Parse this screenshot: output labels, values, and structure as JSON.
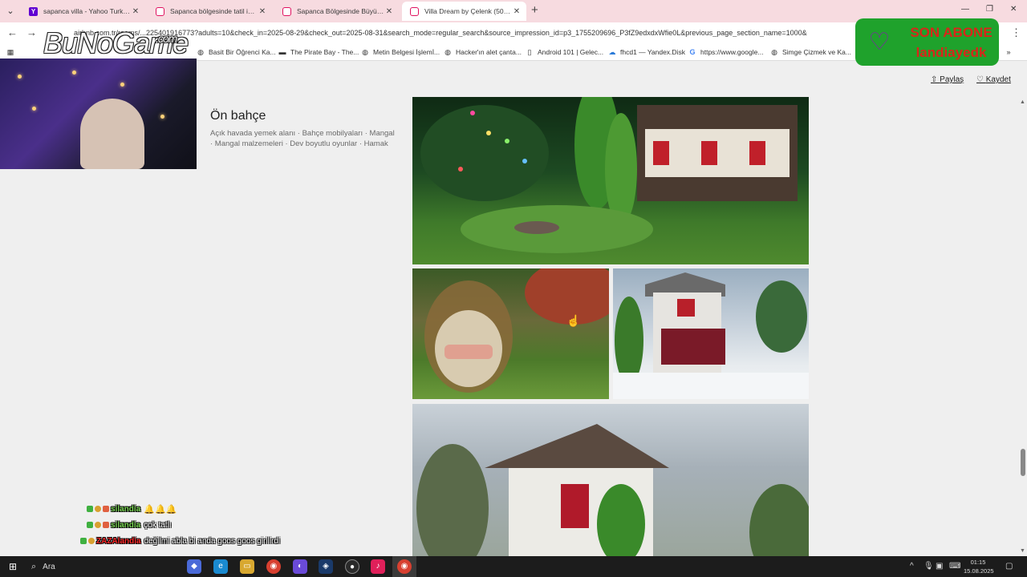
{
  "browser": {
    "tabs": [
      {
        "title": "sapanca villa - Yahoo Turkey Ar",
        "favicon": "yahoo"
      },
      {
        "title": "Sapanca bölgesinde tatil için ki",
        "favicon": "airbnb"
      },
      {
        "title": "Sapanca Bölgesinde Büyük Gru",
        "favicon": "airbnb"
      },
      {
        "title": "Villa Dream by Çelenk (5000 m",
        "favicon": "airbnb",
        "active": true
      }
    ],
    "new_tab_label": "+",
    "url": "airbnb.com.tr/rooms/...225401916773?adults=10&check_in=2025-08-29&check_out=2025-08-31&search_mode=regular_search&source_impression_id=p3_1755209696_P3fZ9edxdxWfie0L&previous_page_section_name=1000&",
    "bookmarks": [
      "Basit Bir Öğrenci Ka...",
      "The Pirate Bay - The...",
      "Metin Belgesi İşlemİ...",
      "Hacker'ın alet çanta...",
      "Android 101 | Gelec...",
      "fhcd1 — Yandex.Disk",
      "https://www.google...",
      "Simge Çizmek ve Ka..."
    ]
  },
  "page": {
    "share_label": "Paylaş",
    "save_label": "Kaydet",
    "section_title": "Ön bahçe",
    "section_description": "Açık havada yemek alanı · Bahçe mobilyaları · Mangal · Mangal malzemeleri · Dev boyutlu oyunlar · Hamak"
  },
  "overlay": {
    "logo_text": "BuNoGame",
    "logo_suffix": ".com",
    "sub_heading": "SON ABONE",
    "sub_name": "landiayedk",
    "chat": [
      {
        "user": "silandia",
        "message": "",
        "color": "#7dd957"
      },
      {
        "user": "silandia",
        "message": "çok tatlı",
        "color": "#7dd957"
      },
      {
        "user": "ZAZAlandia",
        "message": "değilmi abla bi anda goos goos girilirdi",
        "color": "#ff2a2a"
      }
    ]
  },
  "taskbar": {
    "search_label": "Ara",
    "time": "01:15",
    "date": "15.08.2025"
  }
}
